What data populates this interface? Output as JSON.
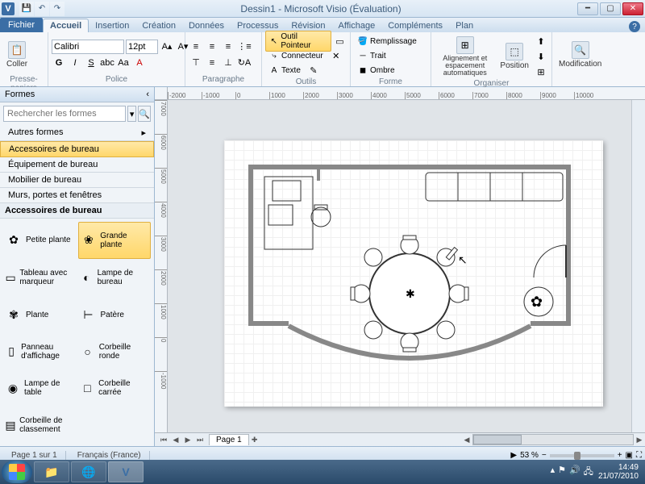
{
  "titlebar": {
    "app_icon_letter": "V",
    "title": "Dessin1 - Microsoft Visio (Évaluation)"
  },
  "qat": [
    "save",
    "undo",
    "redo"
  ],
  "tabs": {
    "file": "Fichier",
    "items": [
      "Accueil",
      "Insertion",
      "Création",
      "Données",
      "Processus",
      "Révision",
      "Affichage",
      "Compléments",
      "Plan"
    ],
    "active_index": 0
  },
  "ribbon": {
    "clipboard": {
      "paste": "Coller",
      "label": "Presse-papiers"
    },
    "font": {
      "name": "Calibri",
      "size": "12pt",
      "label": "Police"
    },
    "paragraph": {
      "label": "Paragraphe"
    },
    "tools": {
      "pointer": "Outil Pointeur",
      "connector": "Connecteur",
      "text": "Texte",
      "label": "Outils"
    },
    "shape": {
      "fill": "Remplissage",
      "line": "Trait",
      "shadow": "Ombre",
      "label": "Forme"
    },
    "arrange": {
      "align": "Alignement et espacement automatiques",
      "position": "Position",
      "label": "Organiser"
    },
    "editing": {
      "modify": "Modification"
    }
  },
  "shapes_panel": {
    "title": "Formes",
    "search_placeholder": "Rechercher les formes",
    "categories": [
      "Autres formes",
      "Accessoires de bureau",
      "Équipement de bureau",
      "Mobilier de bureau",
      "Murs, portes et fenêtres"
    ],
    "active_category_index": 1,
    "section_title": "Accessoires de bureau",
    "items": [
      {
        "label": "Petite plante",
        "icon": "✿"
      },
      {
        "label": "Grande plante",
        "icon": "❀"
      },
      {
        "label": "Tableau avec marqueur",
        "icon": "▭"
      },
      {
        "label": "Lampe de bureau",
        "icon": "◐"
      },
      {
        "label": "Plante",
        "icon": "✾"
      },
      {
        "label": "Patère",
        "icon": "⊢"
      },
      {
        "label": "Panneau d'affichage",
        "icon": "▯"
      },
      {
        "label": "Corbeille ronde",
        "icon": "○"
      },
      {
        "label": "Lampe de table",
        "icon": "◉"
      },
      {
        "label": "Corbeille carrée",
        "icon": "□"
      },
      {
        "label": "Corbeille de classement",
        "icon": "▤"
      }
    ],
    "selected_item_index": 1
  },
  "ruler": {
    "h": [
      "-2000",
      "-1000",
      "0",
      "1000",
      "2000",
      "3000",
      "4000",
      "5000",
      "6000",
      "7000",
      "8000",
      "9000",
      "10000"
    ],
    "v": [
      "7000",
      "6000",
      "5000",
      "4000",
      "3000",
      "2000",
      "1000",
      "0",
      "-1000"
    ]
  },
  "page_tabs": {
    "current": "Page 1"
  },
  "statusbar": {
    "page": "Page 1 sur 1",
    "lang": "Français (France)",
    "zoom": "53 %"
  },
  "taskbar": {
    "time": "14:49",
    "date": "21/07/2010"
  }
}
